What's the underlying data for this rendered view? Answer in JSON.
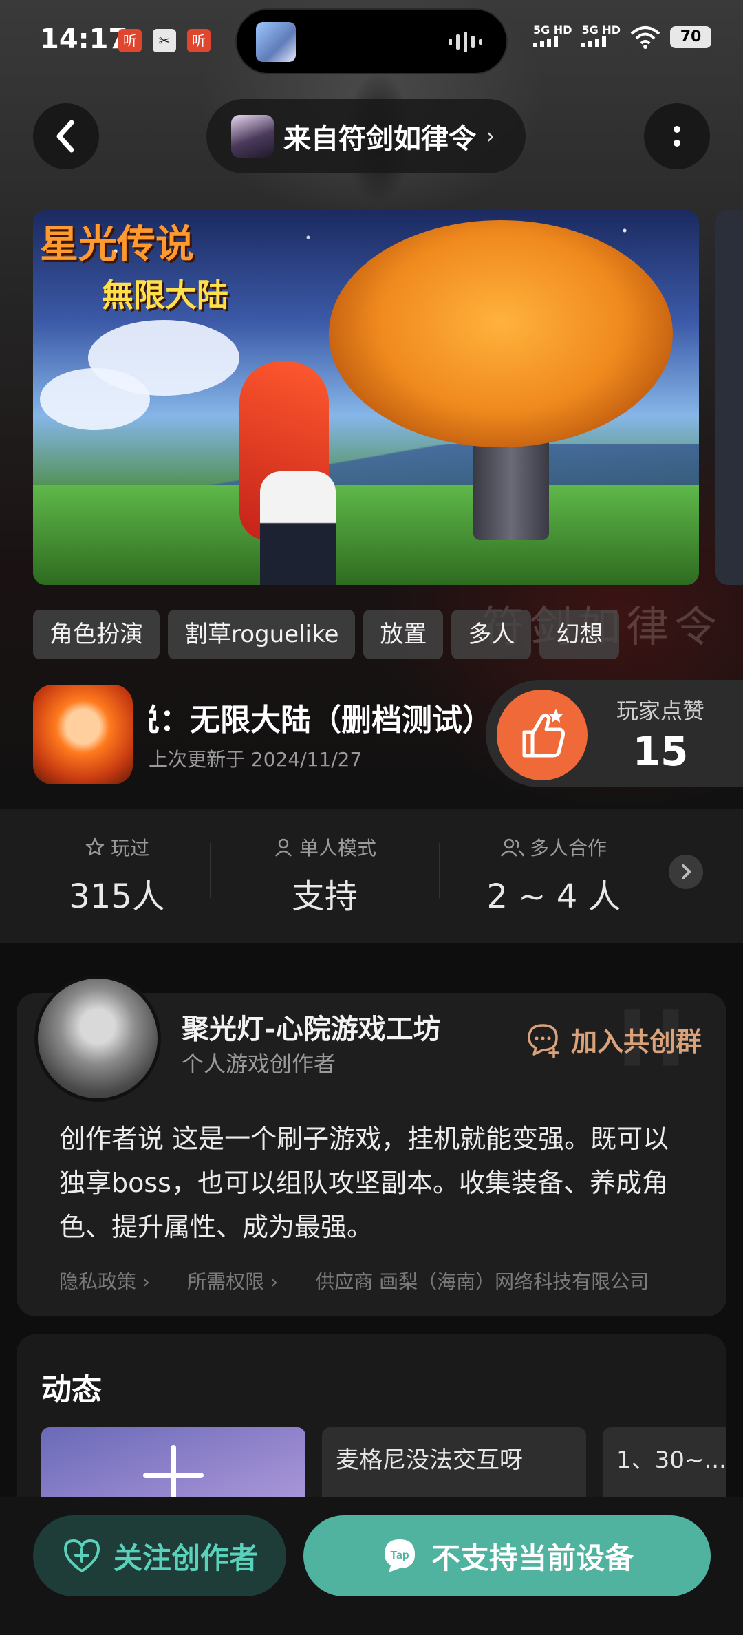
{
  "status_bar": {
    "time": "14:17",
    "mini_icons": [
      "听",
      "✂",
      "听"
    ],
    "signal_1": "5G HD",
    "signal_2": "5G HD",
    "battery": "70"
  },
  "header": {
    "source_label": "来自符剑如律令",
    "source_chevron": "›"
  },
  "banner": {
    "title": "星光传说",
    "subtitle": "無限大陆"
  },
  "tags": [
    "角色扮演",
    "割草roguelike",
    "放置",
    "多人",
    "幻想"
  ],
  "background_text": "符剑如律令",
  "game": {
    "title": "星光传说：无限大陆（删档测试）",
    "updated": "上次更新于 2024/11/27",
    "likes_label": "玩家点赞",
    "likes_count": "15"
  },
  "stats": [
    {
      "label": "玩过",
      "value": "315人",
      "icon": "star-icon"
    },
    {
      "label": "单人模式",
      "value": "支持",
      "icon": "person-icon"
    },
    {
      "label": "多人合作",
      "value": "2 ~ 4 人",
      "icon": "people-icon"
    }
  ],
  "creator": {
    "name": "聚光灯-心院游戏工坊",
    "role": "个人游戏创作者",
    "join_label": "加入共创群",
    "says": "创作者说 这是一个刷子游戏，挂机就能变强。既可以独享boss，也可以组队攻坚副本。收集装备、养成角色、提升属性、成为最强。",
    "links": [
      "隐私政策 ›",
      "所需权限 ›",
      "供应商 画梨（海南）网络科技有限公司"
    ]
  },
  "activity": {
    "title": "动态",
    "cards": [
      "",
      "麦格尼没法交互呀",
      "1、30~..."
    ]
  },
  "bottom": {
    "follow_label": "关注创作者",
    "device_label": "不支持当前设备",
    "tap_badge": "Tap"
  },
  "colors": {
    "accent_like": "#ef6a38",
    "accent_teal": "#4fb3a0",
    "creator_link": "#d9a27a"
  }
}
